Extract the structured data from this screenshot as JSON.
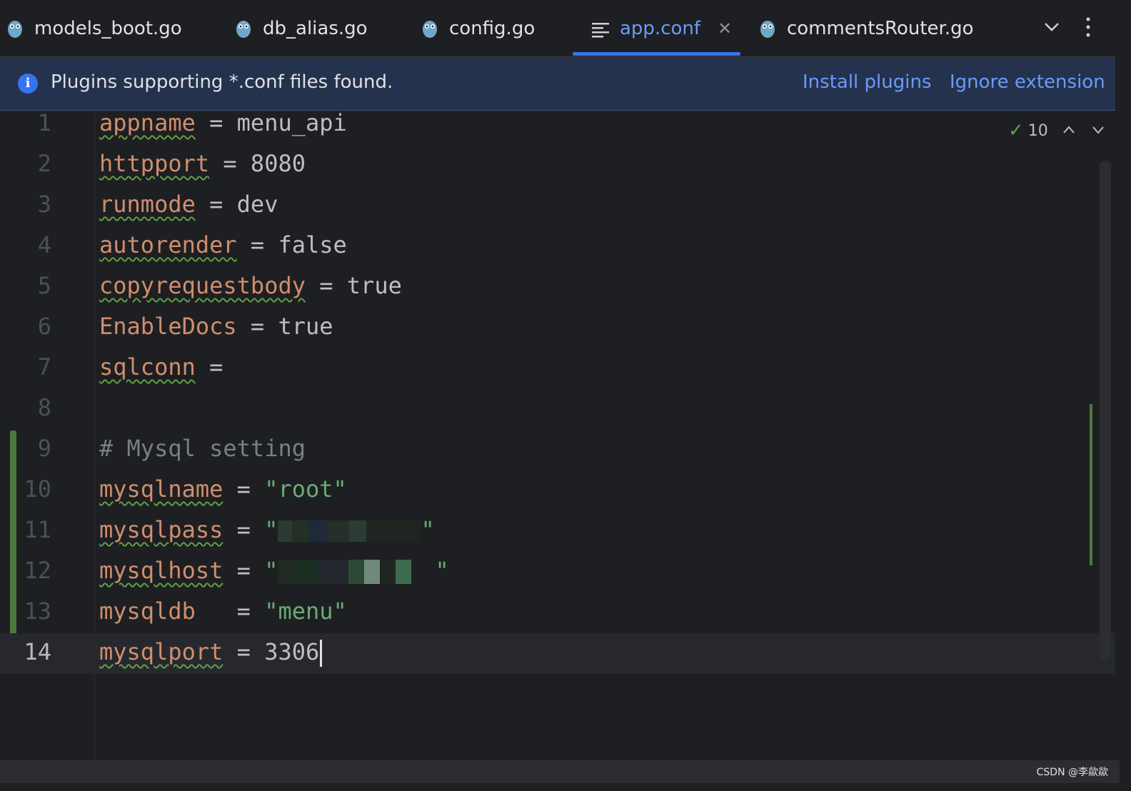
{
  "tabs": [
    {
      "label": "models_boot.go",
      "icon": "gopher-icon"
    },
    {
      "label": "db_alias.go",
      "icon": "gopher-icon"
    },
    {
      "label": "config.go",
      "icon": "gopher-icon"
    },
    {
      "label": "app.conf",
      "icon": "text-file-icon",
      "active": true
    },
    {
      "label": "commentsRouter.go",
      "icon": "gopher-icon"
    }
  ],
  "banner": {
    "message": "Plugins supporting *.conf files found.",
    "install": "Install plugins",
    "ignore": "Ignore extension"
  },
  "inspection": {
    "count": "10"
  },
  "lines": [
    {
      "n": "1",
      "key": "appname",
      "op": " = ",
      "val": "menu_api"
    },
    {
      "n": "2",
      "key": "httpport",
      "op": " = ",
      "val": "8080"
    },
    {
      "n": "3",
      "key": "runmode",
      "op": " = ",
      "val": "dev"
    },
    {
      "n": "4",
      "key": "autorender",
      "op": " = ",
      "val": "false"
    },
    {
      "n": "5",
      "key": "copyrequestbody",
      "op": " = ",
      "val": "true"
    },
    {
      "n": "6",
      "key": "EnableDocs",
      "op": " = ",
      "val": "true"
    },
    {
      "n": "7",
      "key": "sqlconn",
      "op": " =",
      "val": ""
    },
    {
      "n": "8"
    },
    {
      "n": "9",
      "comment": "# Mysql setting"
    },
    {
      "n": "10",
      "key": "mysqlname",
      "op": " = ",
      "str": "\"root\""
    },
    {
      "n": "11",
      "key": "mysqlpass",
      "op": " = "
    },
    {
      "n": "12",
      "key": "mysqlhost",
      "op": " = "
    },
    {
      "n": "13",
      "key": "mysqldb",
      "op": "   = ",
      "str": "\"menu\""
    },
    {
      "n": "14",
      "key": "mysqlport",
      "op": " = ",
      "val": "3306"
    }
  ],
  "watermark": "CSDN @李歘歘",
  "colors": {
    "accent": "#3574f0",
    "key": "#cf8e6d",
    "string": "#6aab73",
    "comment": "#7a7e85"
  }
}
